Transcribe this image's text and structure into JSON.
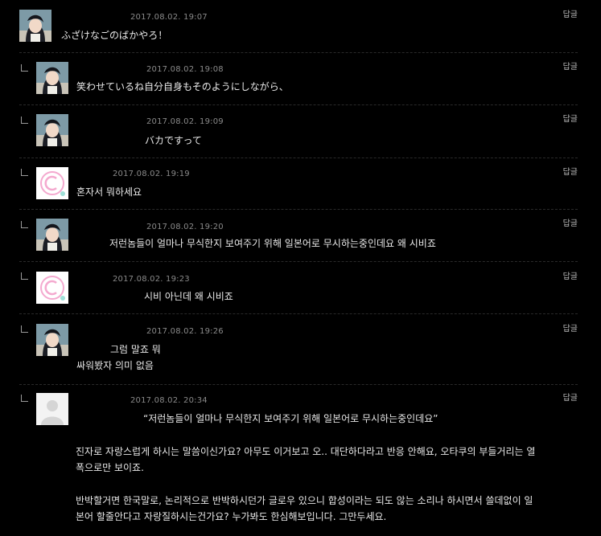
{
  "reply_label": "답글",
  "comments": [
    {
      "date": "2017.08.02. 19:07",
      "lines": [
        "ふざけなごのばかやろ！"
      ],
      "avatar": "anime-avatar"
    },
    {
      "date": "2017.08.02. 19:08",
      "lines": [
        "笑わせているね自分自身もそのようにしながら、"
      ],
      "avatar": "anime-avatar"
    },
    {
      "date": "2017.08.02. 19:09",
      "lines": [
        "バカですって"
      ],
      "avatar": "anime-avatar"
    },
    {
      "date": "2017.08.02. 19:19",
      "lines": [
        "혼자서 뭐하세요"
      ],
      "avatar": "c-logo-avatar"
    },
    {
      "date": "2017.08.02. 19:20",
      "lines": [
        "저런놈들이 얼마나 무식한지 보여주기 위해 일본어로 무시하는중인데요 왜 시비죠"
      ],
      "avatar": "anime-avatar"
    },
    {
      "date": "2017.08.02. 19:23",
      "lines": [
        "시비 아닌데 왜 시비죠"
      ],
      "avatar": "c-logo-avatar"
    },
    {
      "date": "2017.08.02. 19:26",
      "lines": [
        "그럼 말죠 뭐",
        "싸워봤자 의미 없음"
      ],
      "avatar": "anime-avatar"
    },
    {
      "date": "2017.08.02. 20:34",
      "lines": [
        "“저런놈들이 얼마나 무식한지 보여주기 위해 일본어로 무시하는중인데요”",
        "진자로 자랑스럽게 하시는 말씀이신가요? 아무도 이거보고 오.. 대단하다라고 반응 안해요, 오타쿠의 부들거리는 열",
        "폭으로만 보이죠.",
        "반박할거면 한국말로, 논리적으로 반박하시던가 글로우 있으니 합성이라는 되도 않는 소리나 하시면서 쓸데없이 일",
        "본어 할줄안다고 자랑질하시는건가요? 누가봐도 한심해보입니다. 그만두세요."
      ],
      "avatar": "default-avatar"
    }
  ]
}
